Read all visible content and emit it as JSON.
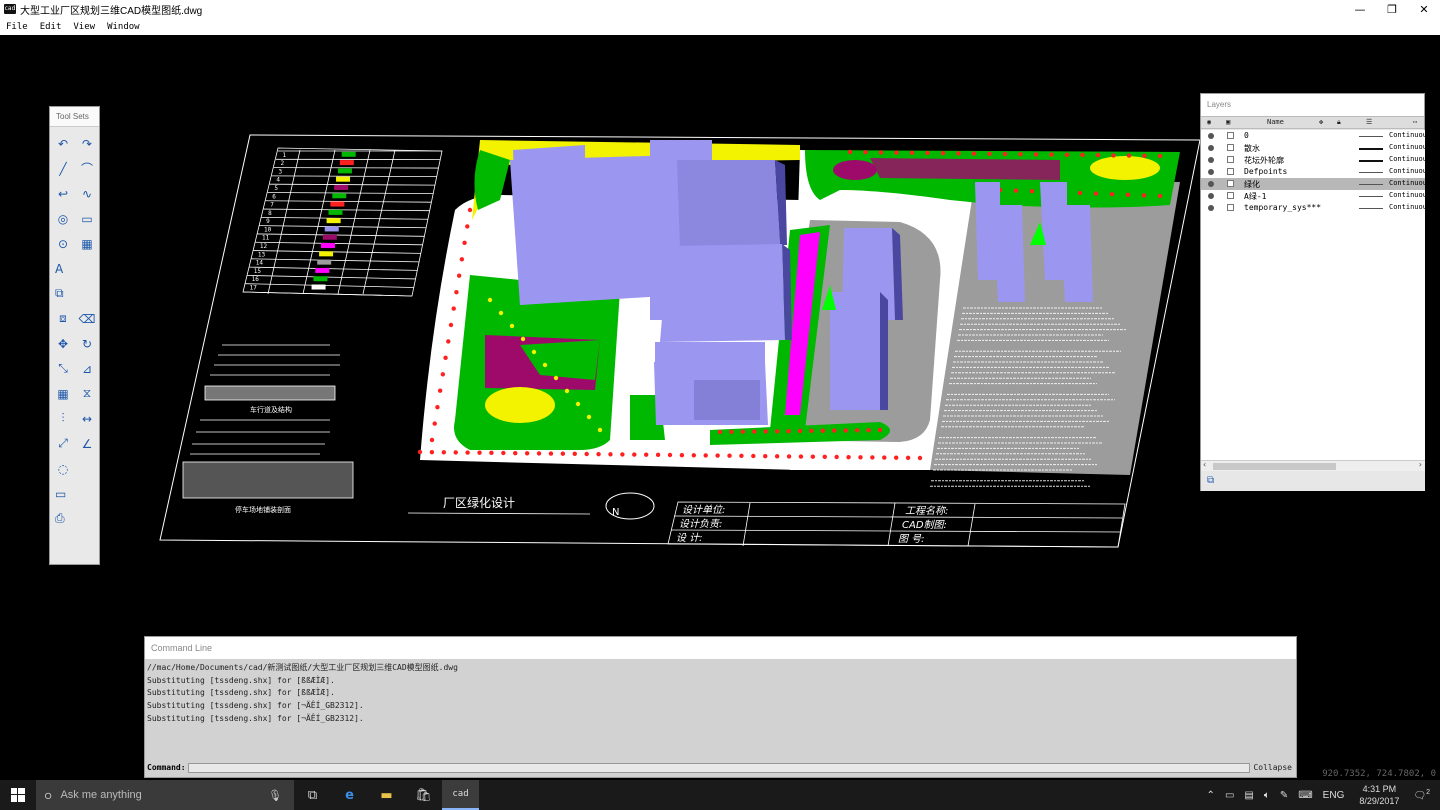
{
  "window": {
    "title": "大型工业厂区规划三维CAD模型图纸.dwg",
    "app_icon_text": "cad",
    "controls": [
      "—",
      "❐",
      "✕"
    ]
  },
  "menu": [
    "File",
    "Edit",
    "View",
    "Window"
  ],
  "drawing": {
    "title": "厂区绿化设计",
    "north_symbol": "N",
    "title_block": {
      "design_unit": "设计单位:",
      "design_lead": "设计负责:",
      "designer": "设     计:",
      "project_name": "工程名称:",
      "cad_drawing": "CAD制图:",
      "drawing_number": "图     号:"
    },
    "section_label_1": "车行道及结构",
    "section_label_2": "停车场地铺装剖面",
    "legend_rows": [
      "1",
      "2",
      "3",
      "4",
      "5",
      "6",
      "7",
      "8",
      "9",
      "10",
      "11",
      "12",
      "13",
      "14",
      "15",
      "16",
      "17"
    ],
    "colors": {
      "building": "#9b97f0",
      "green": "#00b800",
      "magenta": "#9e0a6a",
      "yellow": "#f3f300",
      "grey": "#9c9c9c",
      "road": "#ffffff"
    }
  },
  "toolsets": {
    "title": "Tool Sets",
    "tools": [
      {
        "name": "undo-icon",
        "glyph": "↶"
      },
      {
        "name": "redo-icon",
        "glyph": "↷"
      },
      {
        "name": "line-icon",
        "glyph": "╱"
      },
      {
        "name": "arc-icon",
        "glyph": "⌒"
      },
      {
        "name": "polyline-icon",
        "glyph": "↩"
      },
      {
        "name": "spline-icon",
        "glyph": "∿"
      },
      {
        "name": "circle-icon",
        "glyph": "◎"
      },
      {
        "name": "rectangle-icon",
        "glyph": "▭"
      },
      {
        "name": "ellipse-icon",
        "glyph": "⊙"
      },
      {
        "name": "hatch-icon",
        "glyph": "▦"
      },
      {
        "name": "text-icon",
        "glyph": "A"
      },
      {
        "name": "block-icon",
        "glyph": "⧉"
      },
      {
        "name": "insert-icon",
        "glyph": "⧈"
      },
      {
        "name": "erase-icon",
        "glyph": "⌫"
      },
      {
        "name": "move-icon",
        "glyph": "✥"
      },
      {
        "name": "rotate-icon",
        "glyph": "↻"
      },
      {
        "name": "scale-icon",
        "glyph": "⤡"
      },
      {
        "name": "trim-icon",
        "glyph": "⊿"
      },
      {
        "name": "array-icon",
        "glyph": "▦"
      },
      {
        "name": "mirror-icon",
        "glyph": "⧖"
      },
      {
        "name": "offset-icon",
        "glyph": "⫶"
      },
      {
        "name": "dimension-linear-icon",
        "glyph": "↔"
      },
      {
        "name": "dimension-aligned-icon",
        "glyph": "⤢"
      },
      {
        "name": "dimension-angular-icon",
        "glyph": "∠"
      },
      {
        "name": "dimension-radius-icon",
        "glyph": "◌"
      },
      {
        "name": "viewport-icon",
        "glyph": "▭"
      },
      {
        "name": "plot-icon",
        "glyph": "⎙"
      }
    ]
  },
  "layers": {
    "title": "Layers",
    "header": {
      "name": "Name"
    },
    "rows": [
      {
        "name": "0",
        "linetype": "Continuous",
        "selected": false,
        "thick": false
      },
      {
        "name": "散水",
        "linetype": "Continuous",
        "selected": false,
        "thick": true
      },
      {
        "name": "花坛外轮廓",
        "linetype": "Continuous",
        "selected": false,
        "thick": true
      },
      {
        "name": "Defpoints",
        "linetype": "Continuous",
        "selected": false,
        "thick": false
      },
      {
        "name": "绿化",
        "linetype": "Continuous",
        "selected": true,
        "thick": false
      },
      {
        "name": "A绿-1",
        "linetype": "Continuous",
        "selected": false,
        "thick": false
      },
      {
        "name": "temporary_sys***",
        "linetype": "Continuous",
        "selected": false,
        "thick": false
      }
    ]
  },
  "command_line": {
    "title": "Command Line",
    "output": [
      "//mac/Home/Documents/cad/新测试图纸/大型工业厂区规划三维CAD模型图纸.dwg",
      "Substituting [tssdeng.shx] for [ßßÆÌÆ].",
      "Substituting [tssdeng.shx] for [ßßÆÌÆ].",
      "Substituting [tssdeng.shx] for [¬ÄÊÍ_GB2312].",
      "Substituting [tssdeng.shx] for [¬ÄÊÍ_GB2312]."
    ],
    "prompt": "Command:",
    "collapse": "Collapse"
  },
  "coordinates": "920.7352, 724.7802, 0",
  "taskbar": {
    "search_placeholder": "Ask me anything",
    "time": "4:31 PM",
    "date": "8/29/2017",
    "language": "ENG",
    "notifications": "2"
  }
}
